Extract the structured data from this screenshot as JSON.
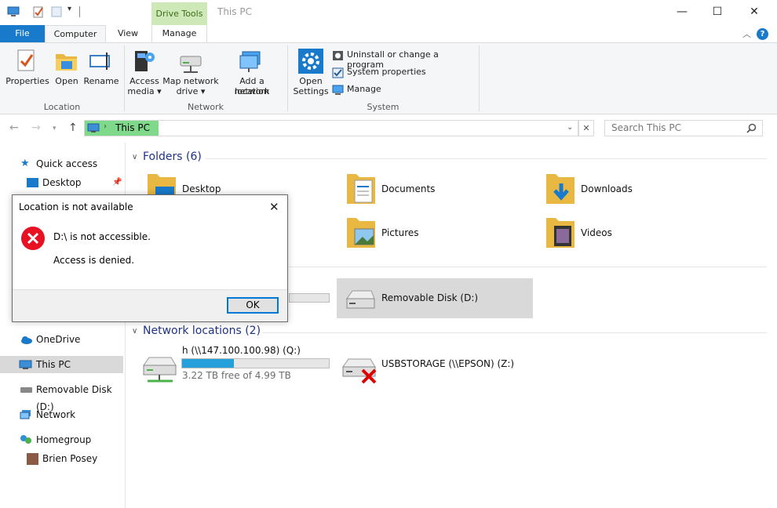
{
  "titlebar": {
    "drive_tools": "Drive Tools",
    "title": "This PC",
    "minimize": "—",
    "maximize": "☐",
    "close": "✕"
  },
  "tabs": {
    "file": "File",
    "computer": "Computer",
    "view": "View",
    "manage": "Manage",
    "help": "?"
  },
  "ribbon": {
    "properties": "Properties",
    "open": "Open",
    "rename": "Rename",
    "access_media_1": "Access",
    "access_media_2": "media ▾",
    "map_drive_1": "Map network",
    "map_drive_2": "drive ▾",
    "add_location_1": "Add a network",
    "add_location_2": "location",
    "open_settings_1": "Open",
    "open_settings_2": "Settings",
    "uninstall": "Uninstall or change a program",
    "system_properties": "System properties",
    "manage": "Manage",
    "group_location": "Location",
    "group_network": "Network",
    "group_system": "System"
  },
  "address": {
    "path": "This PC",
    "search_placeholder": "Search This PC"
  },
  "nav": {
    "quick_access": "Quick access",
    "desktop": "Desktop",
    "onedrive": "OneDrive",
    "this_pc": "This PC",
    "removable": "Removable Disk (D:)",
    "network": "Network",
    "homegroup": "Homegroup",
    "user": "Brien Posey"
  },
  "content": {
    "folders_head": "Folders (6)",
    "folders": [
      "Desktop",
      "Documents",
      "Downloads",
      "Pictures",
      "Videos"
    ],
    "removable_disk": "Removable Disk (D:)",
    "network_head": "Network locations (2)",
    "net_drive_name": "h (\\\\147.100.100.98) (Q:)",
    "net_drive_free": "3.22 TB free of 4.99 TB",
    "net_drive_used_fraction": 0.355,
    "usb_storage": "USBSTORAGE (\\\\EPSON) (Z:)"
  },
  "dialog": {
    "title": "Location is not available",
    "message": "D:\\ is not accessible.",
    "detail": "Access is denied.",
    "ok": "OK",
    "close": "✕"
  }
}
